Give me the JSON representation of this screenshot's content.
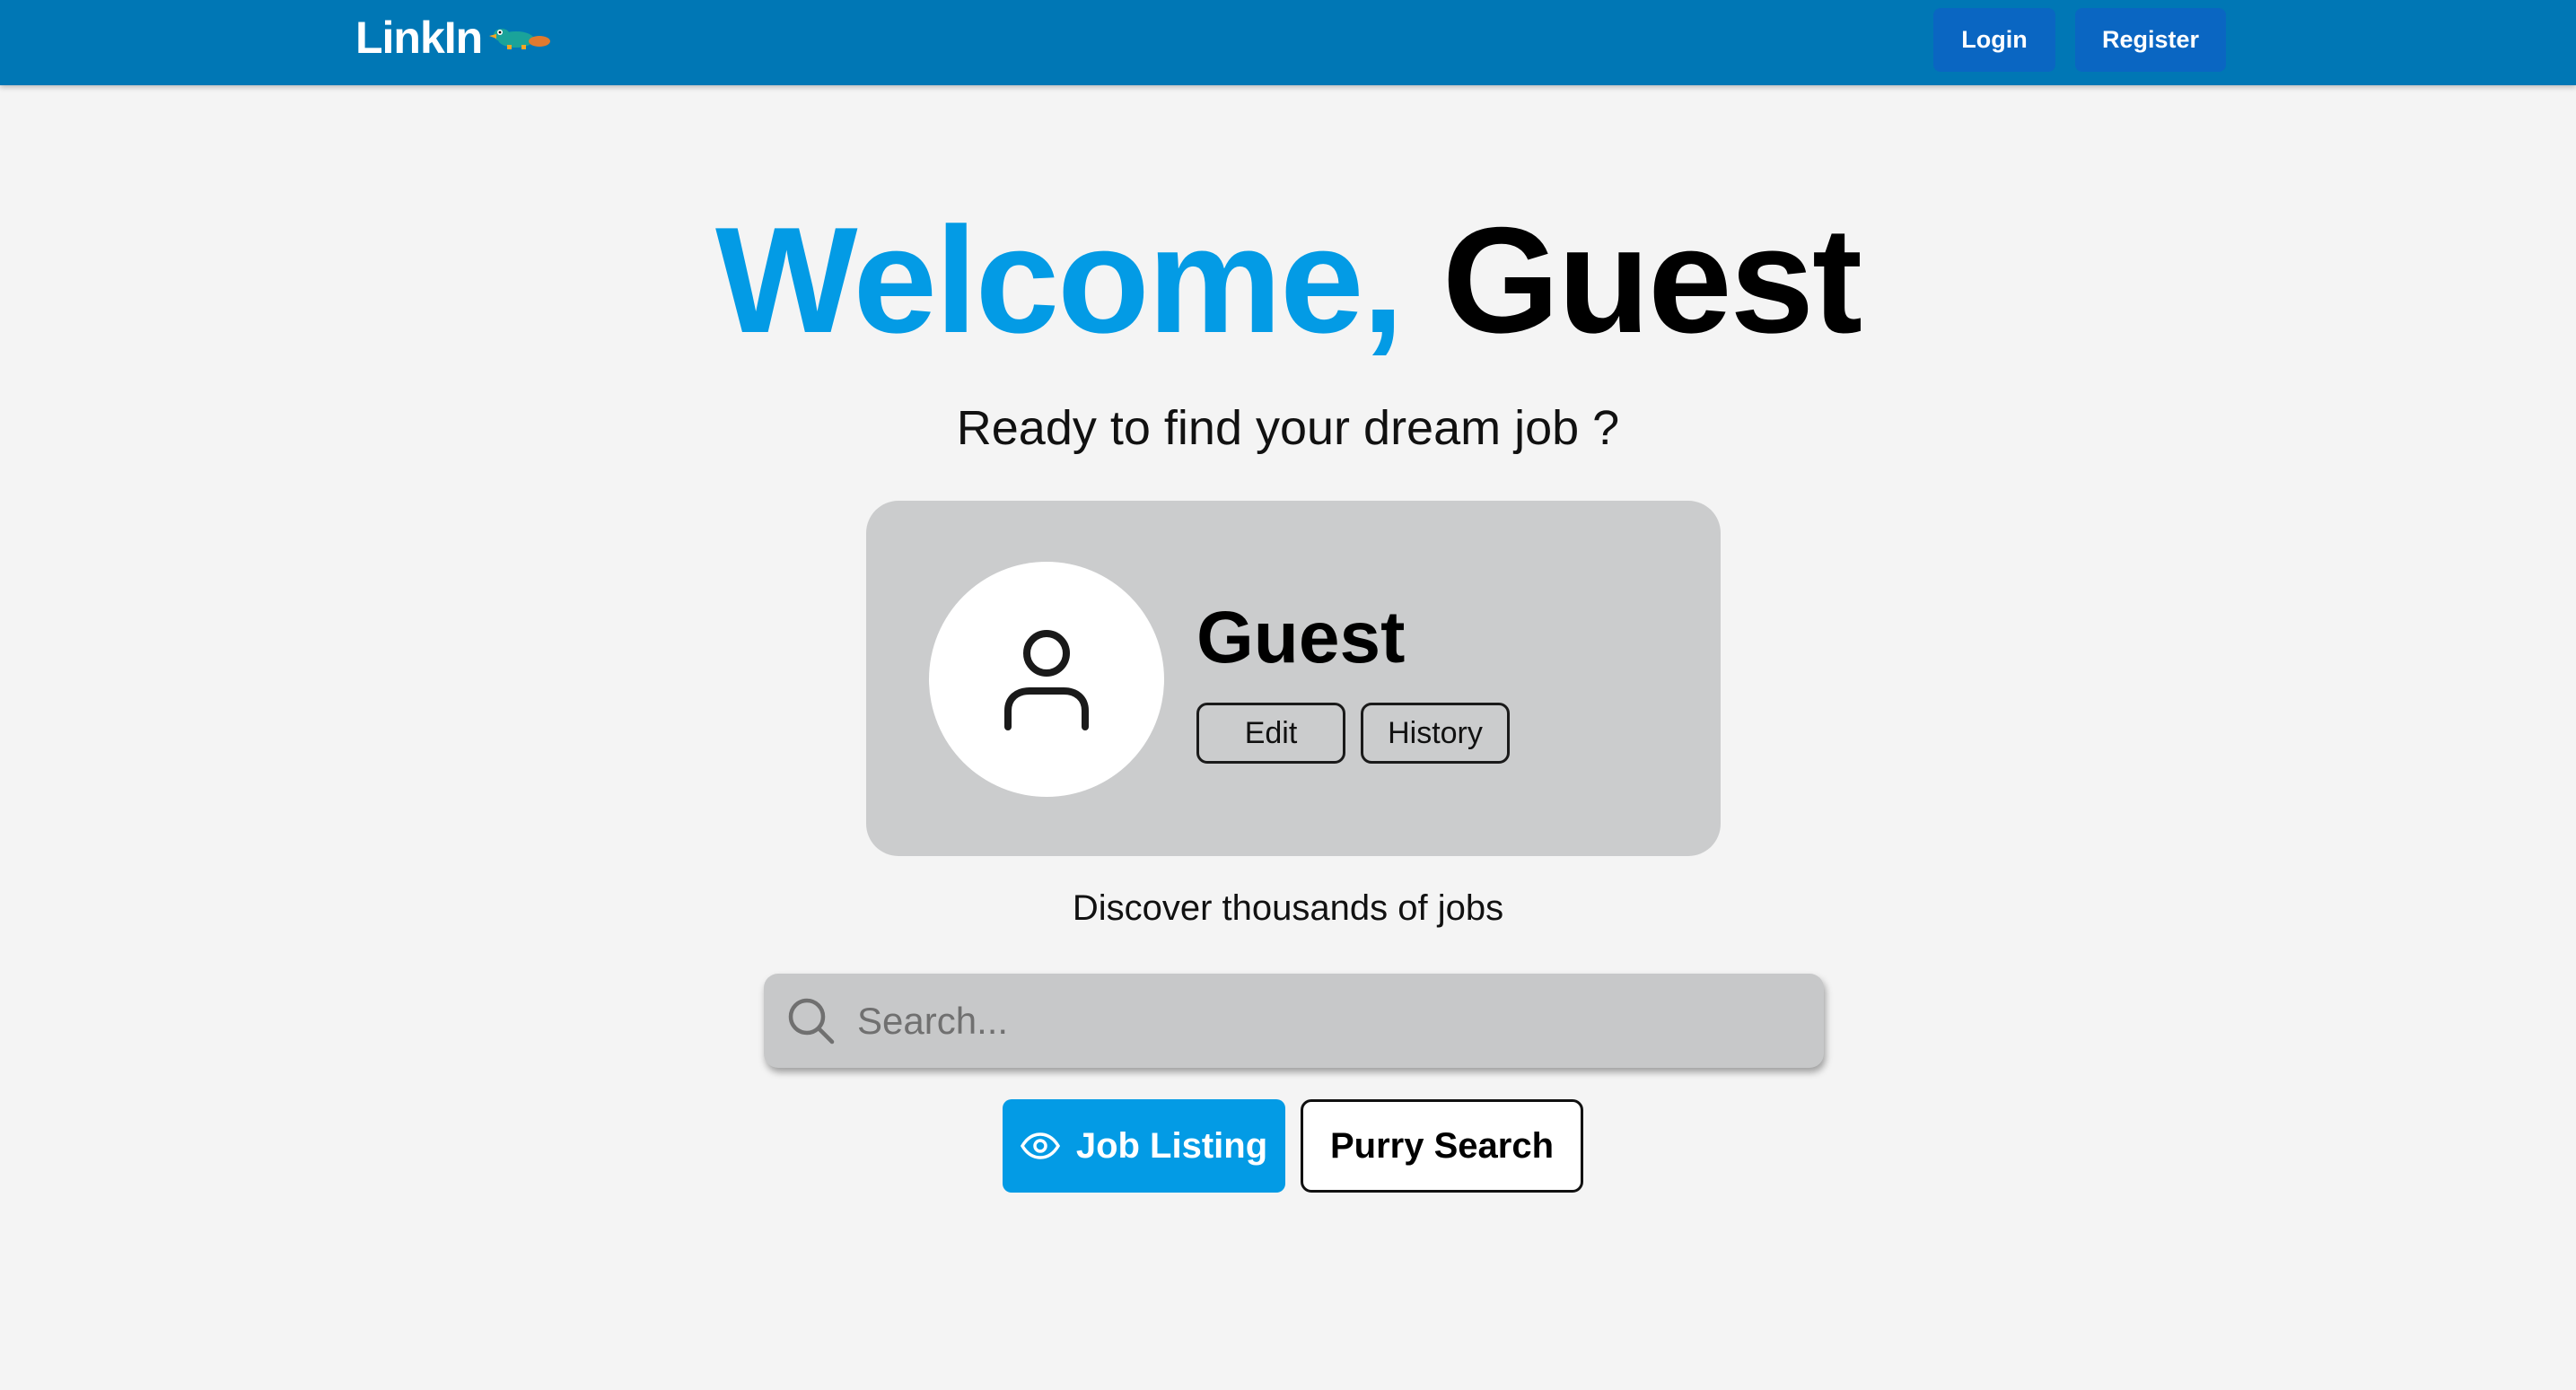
{
  "header": {
    "logo_text": "LinkIn",
    "logo_mascot": "platypus-mascot-icon",
    "login_label": "Login",
    "register_label": "Register",
    "bg_color": "#0077b5",
    "button_color": "#0a66c2"
  },
  "hero": {
    "welcome": "Welcome,",
    "name": "Guest",
    "subtitle": "Ready to find your dream job ?",
    "accent_color": "#039be5"
  },
  "profile": {
    "avatar_icon": "user-icon",
    "name": "Guest",
    "edit_label": "Edit",
    "history_label": "History"
  },
  "discover": {
    "text": "Discover thousands of jobs"
  },
  "search": {
    "placeholder": "Search...",
    "value": "",
    "icon": "search-icon"
  },
  "actions": {
    "job_listing_label": "Job Listing",
    "job_listing_icon": "eye-icon",
    "purry_search_label": "Purry Search"
  }
}
